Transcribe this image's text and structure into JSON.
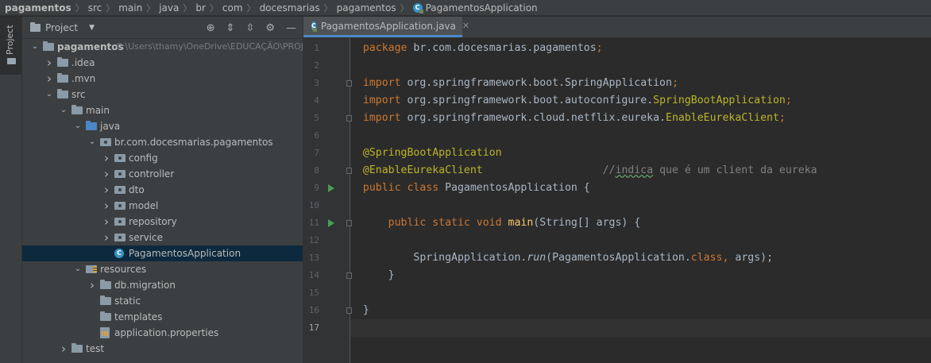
{
  "breadcrumb": [
    "pagamentos",
    "src",
    "main",
    "java",
    "br",
    "com",
    "docesmarias",
    "pagamentos",
    "PagamentosApplication"
  ],
  "left_strip": {
    "project_label": "Project"
  },
  "project_panel": {
    "title": "Project",
    "tree": [
      {
        "label": "pagamentos",
        "path": "C:\\Users\\thamy\\OneDrive\\EDUCAÇÃO\\PROJ",
        "icon": "folder-icon",
        "depth": 0,
        "state": "expanded",
        "bold": true
      },
      {
        "label": ".idea",
        "icon": "folder-icon",
        "depth": 1,
        "state": "collapsed"
      },
      {
        "label": ".mvn",
        "icon": "folder-icon",
        "depth": 1,
        "state": "collapsed"
      },
      {
        "label": "src",
        "icon": "folder-icon",
        "depth": 1,
        "state": "expanded"
      },
      {
        "label": "main",
        "icon": "folder-icon",
        "depth": 2,
        "state": "expanded"
      },
      {
        "label": "java",
        "icon": "source-folder-icon",
        "depth": 3,
        "state": "expanded"
      },
      {
        "label": "br.com.docesmarias.pagamentos",
        "icon": "package-icon",
        "depth": 4,
        "state": "expanded"
      },
      {
        "label": "config",
        "icon": "package-icon",
        "depth": 5,
        "state": "collapsed"
      },
      {
        "label": "controller",
        "icon": "package-icon",
        "depth": 5,
        "state": "collapsed"
      },
      {
        "label": "dto",
        "icon": "package-icon",
        "depth": 5,
        "state": "collapsed"
      },
      {
        "label": "model",
        "icon": "package-icon",
        "depth": 5,
        "state": "collapsed"
      },
      {
        "label": "repository",
        "icon": "package-icon",
        "depth": 5,
        "state": "collapsed"
      },
      {
        "label": "service",
        "icon": "package-icon",
        "depth": 5,
        "state": "collapsed"
      },
      {
        "label": "PagamentosApplication",
        "icon": "spring-class-icon",
        "depth": 5,
        "state": "leaf",
        "selected": true
      },
      {
        "label": "resources",
        "icon": "resources-folder-icon",
        "depth": 3,
        "state": "expanded"
      },
      {
        "label": "db.migration",
        "icon": "folder-icon",
        "depth": 4,
        "state": "collapsed"
      },
      {
        "label": "static",
        "icon": "folder-icon",
        "depth": 4,
        "state": "leaf"
      },
      {
        "label": "templates",
        "icon": "folder-icon",
        "depth": 4,
        "state": "leaf"
      },
      {
        "label": "application.properties",
        "icon": "properties-file-icon",
        "depth": 4,
        "state": "leaf"
      },
      {
        "label": "test",
        "icon": "folder-icon",
        "depth": 2,
        "state": "collapsed"
      }
    ]
  },
  "editor": {
    "tab": "PagamentosApplication.java",
    "current_line": 17,
    "run_lines": [
      9,
      11
    ],
    "fold_lines": [
      3,
      5,
      8,
      11,
      14,
      16
    ],
    "lines": [
      {
        "n": 1,
        "tokens": [
          {
            "t": "package ",
            "c": "kw"
          },
          {
            "t": "br.com.docesmarias.pagamentos",
            "c": "tx"
          },
          {
            "t": ";",
            "c": "kw"
          }
        ]
      },
      {
        "n": 2,
        "tokens": []
      },
      {
        "n": 3,
        "tokens": [
          {
            "t": "import ",
            "c": "kw"
          },
          {
            "t": "org.springframework.boot.SpringApplication",
            "c": "tx"
          },
          {
            "t": ";",
            "c": "kw"
          }
        ]
      },
      {
        "n": 4,
        "tokens": [
          {
            "t": "import ",
            "c": "kw"
          },
          {
            "t": "org.springframework.boot.autoconfigure.",
            "c": "tx"
          },
          {
            "t": "SpringBootApplication",
            "c": "an"
          },
          {
            "t": ";",
            "c": "kw"
          }
        ]
      },
      {
        "n": 5,
        "tokens": [
          {
            "t": "import ",
            "c": "kw"
          },
          {
            "t": "org.springframework.cloud.netflix.eureka.",
            "c": "tx"
          },
          {
            "t": "EnableEurekaClient",
            "c": "an"
          },
          {
            "t": ";",
            "c": "kw"
          }
        ]
      },
      {
        "n": 6,
        "tokens": []
      },
      {
        "n": 7,
        "tokens": [
          {
            "t": "@SpringBootApplication",
            "c": "an"
          }
        ]
      },
      {
        "n": 8,
        "tokens": [
          {
            "t": "@EnableEurekaClient",
            "c": "an"
          },
          {
            "t": "                   ",
            "c": "tx"
          },
          {
            "t": "//",
            "c": "cm"
          },
          {
            "t": "indica",
            "c": "cm typo"
          },
          {
            "t": " que é um client da eureka",
            "c": "cm"
          }
        ]
      },
      {
        "n": 9,
        "tokens": [
          {
            "t": "public class ",
            "c": "kw"
          },
          {
            "t": "PagamentosApplication {",
            "c": "tx"
          }
        ]
      },
      {
        "n": 10,
        "tokens": []
      },
      {
        "n": 11,
        "tokens": [
          {
            "t": "    public static void ",
            "c": "kw"
          },
          {
            "t": "main",
            "c": "fn"
          },
          {
            "t": "(String[] args) {",
            "c": "tx"
          }
        ]
      },
      {
        "n": 12,
        "tokens": []
      },
      {
        "n": 13,
        "tokens": [
          {
            "t": "        SpringApplication.",
            "c": "tx"
          },
          {
            "t": "run",
            "c": "it"
          },
          {
            "t": "(PagamentosApplication.",
            "c": "tx"
          },
          {
            "t": "class",
            "c": "kw"
          },
          {
            "t": ", ",
            "c": "kw"
          },
          {
            "t": "args);",
            "c": "tx"
          }
        ]
      },
      {
        "n": 14,
        "tokens": [
          {
            "t": "    }",
            "c": "tx"
          }
        ]
      },
      {
        "n": 15,
        "tokens": []
      },
      {
        "n": 16,
        "tokens": [
          {
            "t": "}",
            "c": "tx"
          }
        ]
      },
      {
        "n": 17,
        "tokens": []
      }
    ]
  }
}
